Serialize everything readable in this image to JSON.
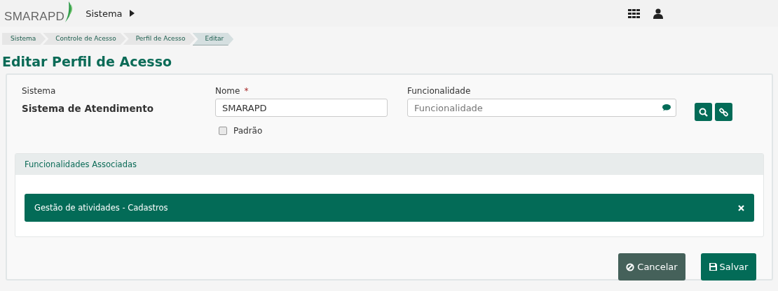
{
  "header": {
    "logo": "SMARAPD",
    "menu": "Sistema"
  },
  "breadcrumb": [
    {
      "label": "Sistema",
      "selected": false
    },
    {
      "label": "Controle de Acesso",
      "selected": false
    },
    {
      "label": "Perfil de Acesso",
      "selected": false
    },
    {
      "label": "Editar",
      "selected": true
    }
  ],
  "title": "Editar Perfil de Acesso",
  "form": {
    "sistema_label": "Sistema",
    "sistema_value": "Sistema de Atendimento",
    "nome_label": "Nome",
    "required_mark": "*",
    "nome_value": "SMARAPD",
    "padrao_label": "Padrão",
    "padrao_checked": false,
    "funcionalidade_label": "Funcionalidade",
    "funcionalidade_placeholder": "Funcionalidade"
  },
  "associated": {
    "title": "Funcionalidades Associadas",
    "items": [
      {
        "label": "Gestão de atividades - Cadastros"
      }
    ]
  },
  "buttons": {
    "cancel": "Cancelar",
    "save": "Salvar"
  }
}
